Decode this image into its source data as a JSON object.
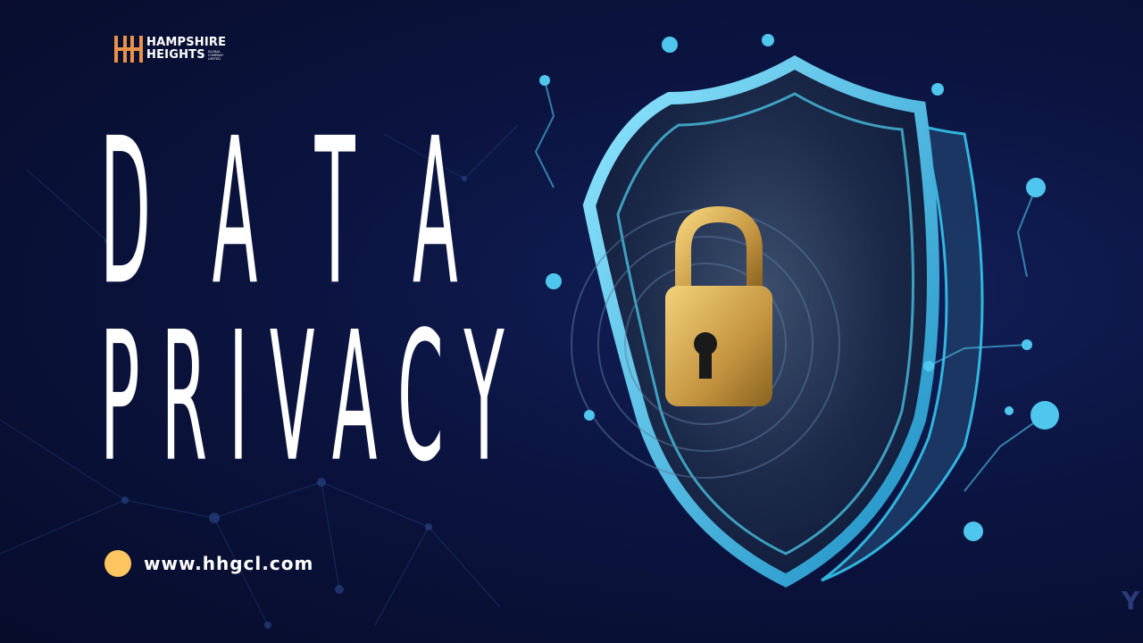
{
  "brand": {
    "name_line1": "HAMPSHIRE",
    "name_line2": "HEIGHTS",
    "subtitle": "GLOBAL COMPANY LIMITED"
  },
  "headline": {
    "line1": "DATA",
    "line2": "PRIVACY"
  },
  "contact": {
    "website": "www.hhgcl.com"
  },
  "graphic": {
    "subject": "padlock-shield-icon",
    "corner_text": "Y"
  },
  "colors": {
    "background": "#0a1033",
    "accent": "#ffc561",
    "shield": "#35c8f0",
    "lock": "#d9a94a",
    "text": "#ffffff"
  }
}
